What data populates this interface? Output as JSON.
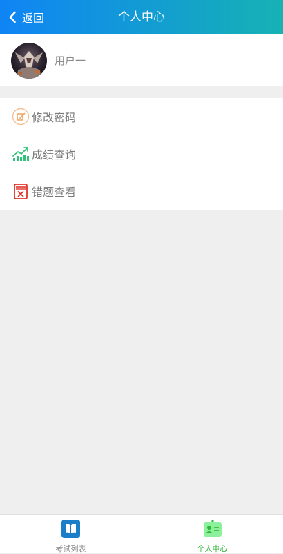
{
  "header": {
    "back_label": "返回",
    "title": "个人中心",
    "back_icon": "chevron-left-icon"
  },
  "profile": {
    "username": "用户一"
  },
  "menu": {
    "items": [
      {
        "label": "修改密码",
        "icon": "edit-password-icon",
        "color": "#f0a35e"
      },
      {
        "label": "成绩查询",
        "icon": "chart-trend-icon",
        "color": "#33c27a"
      },
      {
        "label": "错题查看",
        "icon": "wrong-question-icon",
        "color": "#e0342a"
      }
    ]
  },
  "tabbar": {
    "tabs": [
      {
        "label": "考试列表",
        "icon": "book-icon",
        "color": "#1a7ec9",
        "active": false
      },
      {
        "label": "个人中心",
        "icon": "id-card-icon",
        "color": "#2fb53a",
        "active": true
      }
    ]
  },
  "colors": {
    "header_start": "#0f84f5",
    "header_end": "#16b2b4",
    "background": "#efefef"
  }
}
